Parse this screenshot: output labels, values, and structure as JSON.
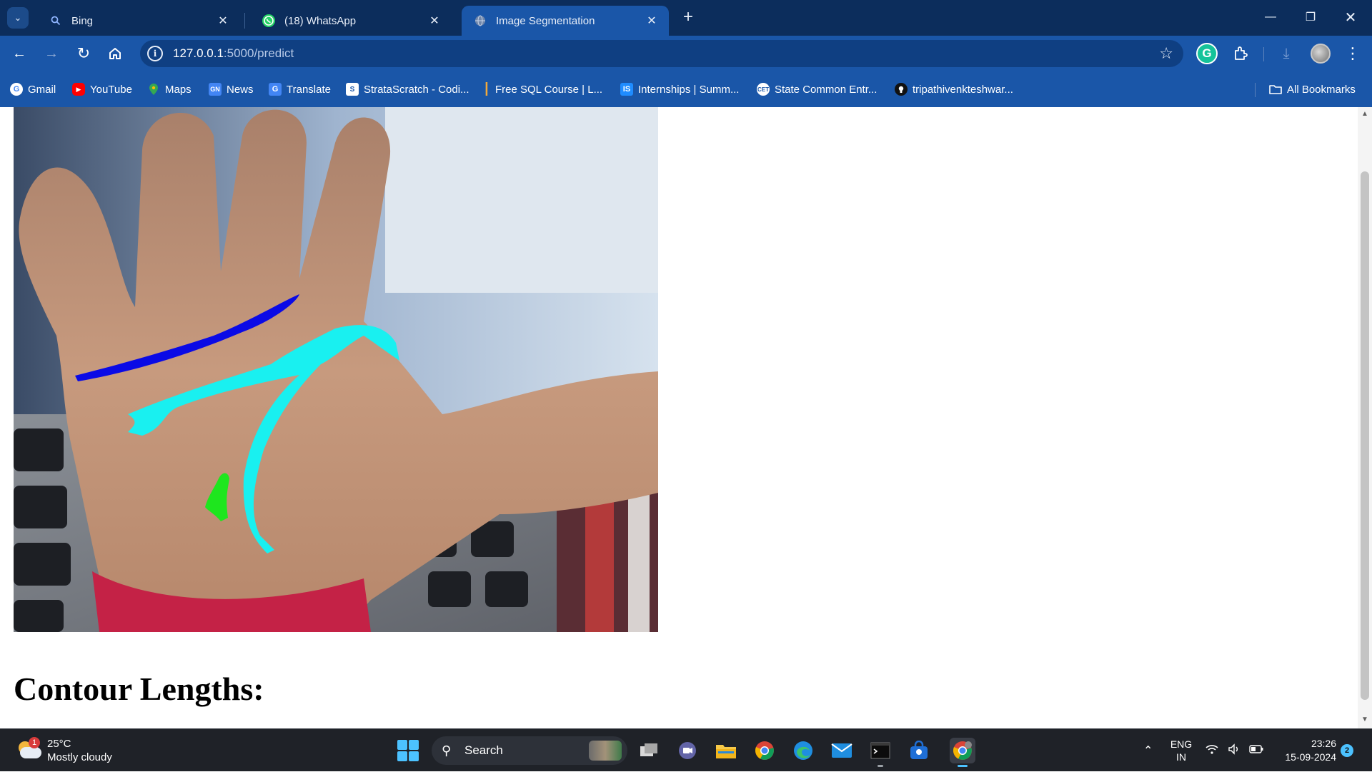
{
  "browser": {
    "tabs": [
      {
        "title": "Bing",
        "icon": "search-icon",
        "active": false
      },
      {
        "title": "(18) WhatsApp",
        "icon": "whatsapp-icon",
        "active": false
      },
      {
        "title": "Image Segmentation",
        "icon": "globe-icon",
        "active": true
      }
    ],
    "url_host": "127.0.0.1",
    "url_path": ":5000/predict",
    "bookmarks": [
      {
        "label": "Gmail",
        "icon": "google-icon",
        "color": "#ffffff"
      },
      {
        "label": "YouTube",
        "icon": "youtube-icon",
        "color": "#ff0000"
      },
      {
        "label": "Maps",
        "icon": "maps-icon",
        "color": "#34a853"
      },
      {
        "label": "News",
        "icon": "news-icon",
        "color": "#4285f4"
      },
      {
        "label": "Translate",
        "icon": "translate-icon",
        "color": "#4285f4"
      },
      {
        "label": "StrataScratch - Codi...",
        "icon": "stratascratch-icon",
        "color": "#ffffff"
      },
      {
        "label": "Free SQL Course | L...",
        "icon": "sql-course-icon",
        "color": "#1f6bd6"
      },
      {
        "label": "Internships | Summ...",
        "icon": "internshala-icon",
        "color": "#1f8cff"
      },
      {
        "label": "State Common Entr...",
        "icon": "cet-icon",
        "color": "#ffffff"
      },
      {
        "label": "tripathivenkteshwar...",
        "icon": "github-icon",
        "color": "#000000"
      }
    ],
    "all_bookmarks_label": "All Bookmarks"
  },
  "page": {
    "image_alt": "Segmented palm image with detected palm lines",
    "line_colors": {
      "top_line": "#0a0ae6",
      "middle_line": "#19f0f0",
      "small_mark": "#1ee61e"
    },
    "heading": "Contour Lengths:"
  },
  "taskbar": {
    "weather_temp": "25°C",
    "weather_desc": "Mostly cloudy",
    "weather_badge": "1",
    "search_label": "Search",
    "apps": [
      "file-manager-icon",
      "teams-meet-icon",
      "file-explorer-icon",
      "chrome-icon",
      "edge-icon",
      "mail-icon",
      "terminal-icon",
      "store-icon",
      "chrome-profile-icon"
    ],
    "lang_top": "ENG",
    "lang_bottom": "IN",
    "time": "23:26",
    "date": "15-09-2024",
    "notification_count": "2"
  }
}
